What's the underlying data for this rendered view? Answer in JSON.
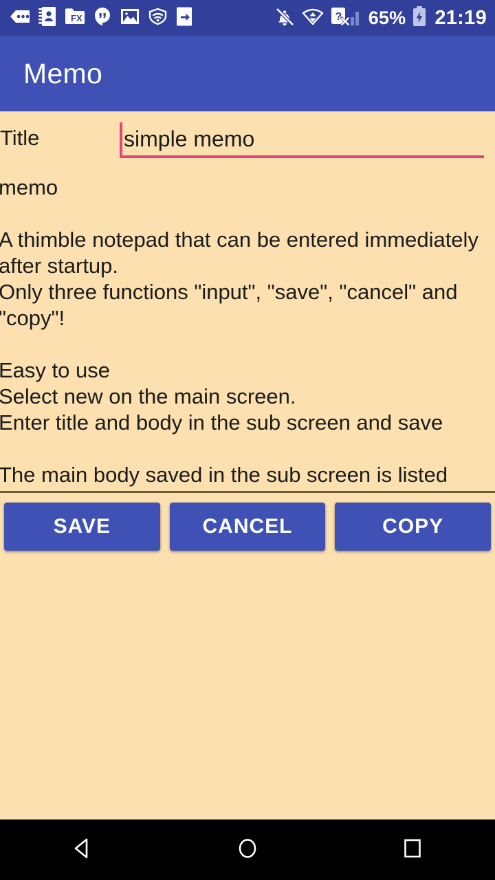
{
  "status_bar": {
    "background": "#32409B",
    "left_icons": [
      "messages-icon",
      "contacts-icon",
      "file-commander-icon",
      "hangouts-icon",
      "photo-icon",
      "vpn-shield-icon",
      "screen-share-icon"
    ],
    "right_icons": [
      "mute-ringer-icon",
      "wifi-icon",
      "no-sim-icon",
      "signal-bars-icon"
    ],
    "battery_percent": "65%",
    "battery_icon": "battery-charging-icon",
    "clock": "21:19"
  },
  "app_bar": {
    "title": "Memo",
    "background": "#3F51B5"
  },
  "form": {
    "title_label": "Title",
    "title_value": "simple memo",
    "title_placeholder": "Title",
    "title_accent_color": "#E8447A",
    "body_value": "memo\n\nA thimble notepad that can be entered immediately after startup.\nOnly three functions \"input\", \"save\", \"cancel\" and \"copy\"!\n\nEasy to use\nSelect new on the main screen.\nEnter title and body in the sub screen and save\n\nThe main body saved in the sub screen is listed",
    "body_placeholder": "memo",
    "body_underline_color": "#6B5A34"
  },
  "buttons": [
    {
      "label": "SAVE",
      "name": "save-button"
    },
    {
      "label": "CANCEL",
      "name": "cancel-button"
    },
    {
      "label": "COPY",
      "name": "copy-button"
    }
  ],
  "nav_bar": {
    "back": "back-icon",
    "home": "home-icon",
    "recents": "recents-icon"
  },
  "colors": {
    "page_background": "#FCE0B0",
    "accent_pink": "#E8447A",
    "primary_blue": "#3F51B5",
    "status_blue": "#32409B"
  }
}
